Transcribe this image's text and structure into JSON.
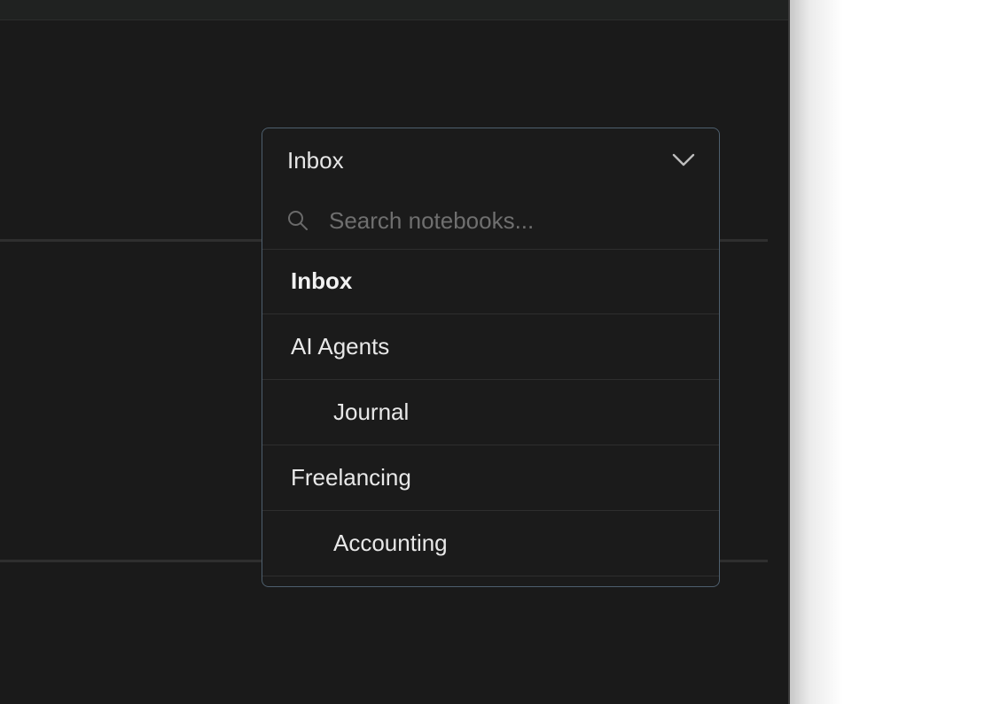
{
  "picker": {
    "selected": "Inbox",
    "search_placeholder": "Search notebooks...",
    "items": [
      {
        "label": "Inbox",
        "level": 0,
        "active": true
      },
      {
        "label": "AI Agents",
        "level": 0,
        "active": false
      },
      {
        "label": "Journal",
        "level": 1,
        "active": false
      },
      {
        "label": "Freelancing",
        "level": 0,
        "active": false
      },
      {
        "label": "Accounting",
        "level": 1,
        "active": false
      }
    ]
  },
  "icons": {
    "dropdown": "chevron-down-icon",
    "search": "search-icon"
  },
  "colors": {
    "background": "#1a1a1a",
    "picker_border": "#4e5f6e",
    "text": "#e6e6e6",
    "placeholder": "#6f6f6f"
  }
}
